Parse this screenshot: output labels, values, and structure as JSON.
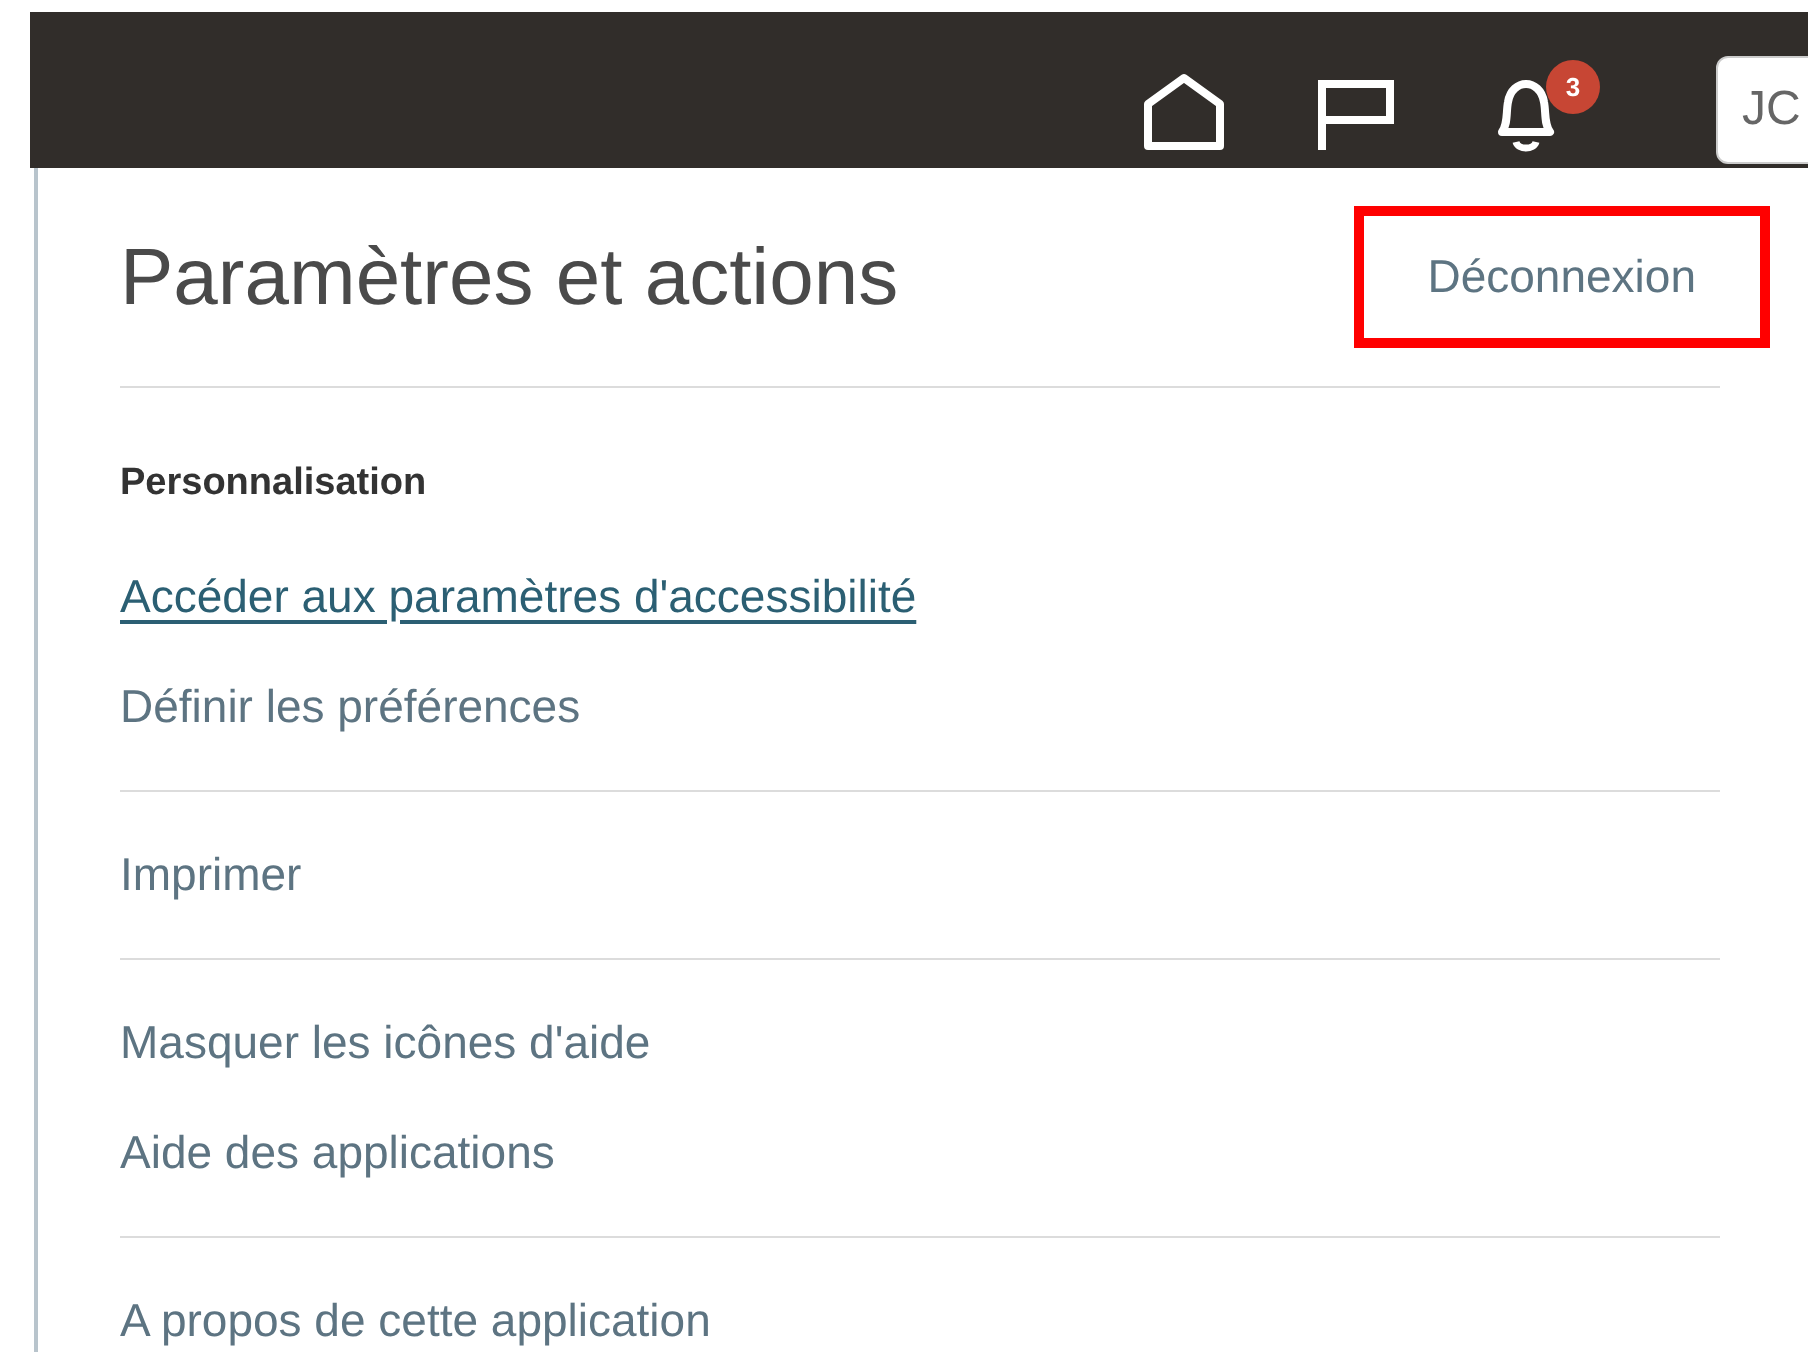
{
  "header": {
    "notification_count": "3",
    "user_initials": "JC"
  },
  "panel": {
    "title": "Paramètres et actions",
    "sign_out": {
      "label": "Déconnexion",
      "highlighted": true
    },
    "groups": [
      {
        "heading": "Personnalisation",
        "items": [
          {
            "label": "Accéder aux paramètres d'accessibilité",
            "focused": true
          },
          {
            "label": "Définir les préférences",
            "focused": false
          }
        ]
      },
      {
        "items": [
          {
            "label": "Imprimer",
            "focused": false
          }
        ]
      },
      {
        "items": [
          {
            "label": "Masquer les icônes d'aide",
            "focused": false
          },
          {
            "label": "Aide des applications",
            "focused": false
          }
        ]
      },
      {
        "items": [
          {
            "label": "A propos de cette application",
            "focused": false
          }
        ]
      }
    ]
  }
}
